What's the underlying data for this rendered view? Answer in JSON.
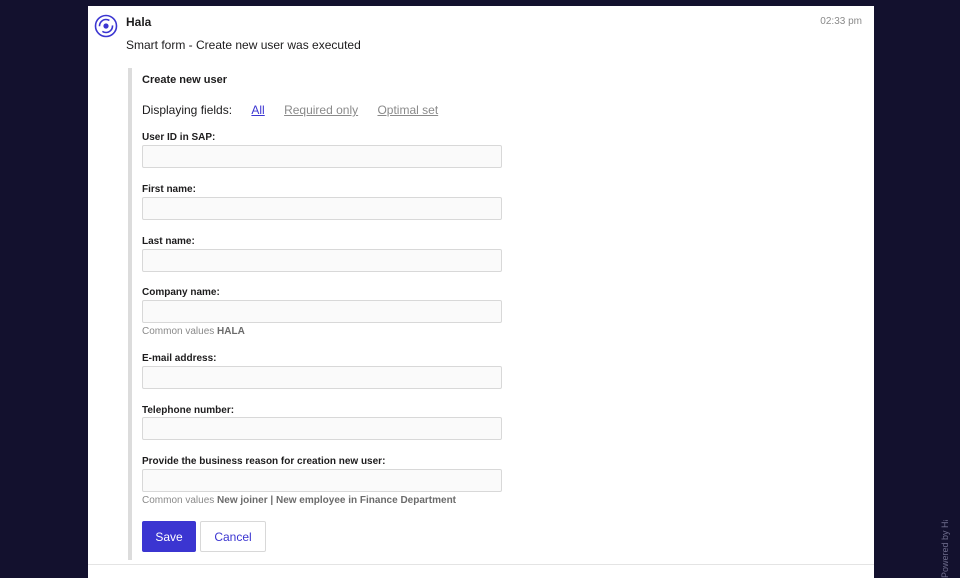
{
  "message": {
    "sender": "Hala",
    "time": "02:33 pm",
    "text": "Smart form - Create new user was executed"
  },
  "form": {
    "title": "Create new user",
    "display_label": "Displaying fields:",
    "display_options": [
      "All",
      "Required only",
      "Optimal set"
    ],
    "active_option": "All",
    "hint_prefix": "Common values",
    "fields": [
      {
        "label": "User ID in SAP:",
        "value": ""
      },
      {
        "label": "First name:",
        "value": ""
      },
      {
        "label": "Last name:",
        "value": ""
      },
      {
        "label": "Company name:",
        "value": "",
        "hint_values": "HALA"
      },
      {
        "label": "E-mail address:",
        "value": ""
      },
      {
        "label": "Telephone number:",
        "value": ""
      },
      {
        "label": "Provide the business reason for creation new user:",
        "value": "",
        "hint_values": "New joiner | New employee in Finance Department"
      }
    ],
    "save_label": "Save",
    "cancel_label": "Cancel"
  },
  "watermark": "Powered by Hala",
  "colors": {
    "accent": "#3b35d1",
    "background": "#13112e",
    "panel": "#ffffff"
  }
}
